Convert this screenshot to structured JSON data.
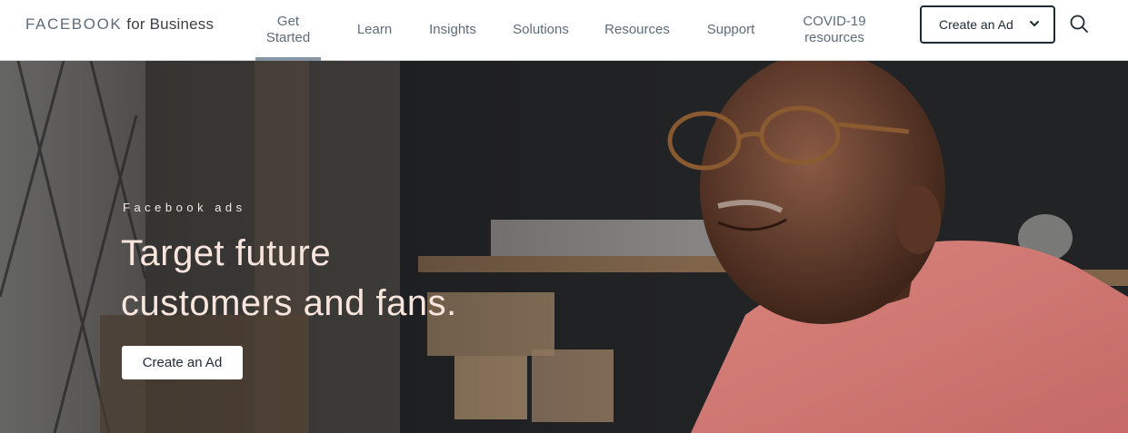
{
  "logo": {
    "brand": "FACEBOOK",
    "suffix": "for Business"
  },
  "nav": [
    {
      "label_line1": "Get",
      "label_line2": "Started",
      "active": true
    },
    {
      "label": "Learn"
    },
    {
      "label": "Insights"
    },
    {
      "label": "Solutions"
    },
    {
      "label": "Resources"
    },
    {
      "label": "Support"
    },
    {
      "label_line1": "COVID-19",
      "label_line2": "resources"
    }
  ],
  "header_cta": {
    "label": "Create an Ad",
    "icon": "chevron-down-icon"
  },
  "search": {
    "icon": "search-icon"
  },
  "hero": {
    "eyebrow": "Facebook ads",
    "headline_line1": "Target future",
    "headline_line2": "customers and fans.",
    "button_label": "Create an Ad"
  },
  "colors": {
    "text": "#1c2b33",
    "nav": "#5d6c7b",
    "active_underline": "#8595a4",
    "headline": "#f7e5de"
  }
}
